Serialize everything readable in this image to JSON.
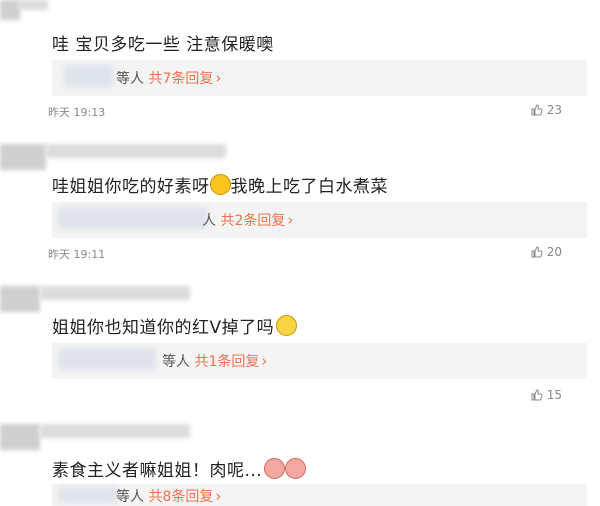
{
  "comments": [
    {
      "text": "哇 宝贝多吃一些 注意保暖噢",
      "reply_prefix": "等人",
      "reply_count": "共7条回复",
      "time": "昨天 19:13",
      "likes": "23"
    },
    {
      "text_before": "哇姐姐你吃的好素呀",
      "emoji": "laughing-tears-emoji",
      "text_after": "我晚上吃了白水煮菜",
      "reply_prefix": "人",
      "reply_count": "共2条回复",
      "time": "昨天 19:11",
      "likes": "20"
    },
    {
      "text": "姐姐你也知道你的红V掉了吗",
      "emoji": "wink-emoji",
      "reply_prefix": "等人",
      "reply_count": "共1条回复",
      "likes": "15"
    },
    {
      "text": "素食主义者嘛姐姐！肉呢...",
      "emoji": "pig-face-emoji",
      "reply_prefix": "等人",
      "reply_count": "共8条回复"
    }
  ],
  "colors": {
    "accent": "#eb7350",
    "reply_bg": "#f4f4f4"
  }
}
